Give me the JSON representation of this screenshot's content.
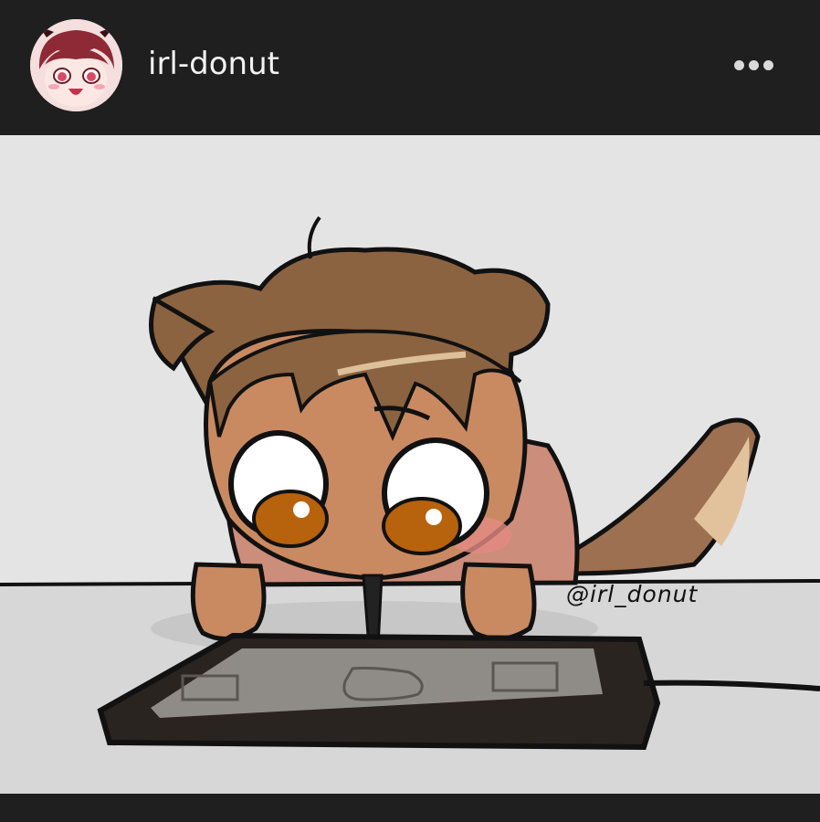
{
  "post": {
    "username": "irl-donut",
    "more_icon": "more-horizontal-icon",
    "image": {
      "watermark": "@irl_donut"
    }
  }
}
